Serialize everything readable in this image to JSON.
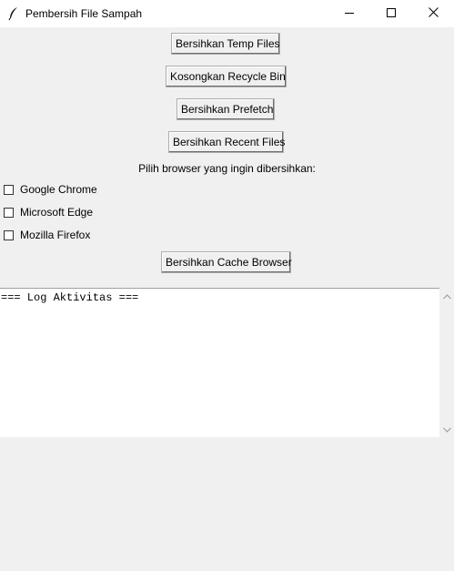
{
  "window": {
    "title": "Pembersih File Sampah"
  },
  "buttons": {
    "temp_files": "Bersihkan Temp Files",
    "recycle_bin": "Kosongkan Recycle Bin",
    "prefetch": "Bersihkan Prefetch",
    "recent_files": "Bersihkan Recent Files",
    "cache_browser": "Bersihkan Cache Browser"
  },
  "browser_section": {
    "prompt": "Pilih browser yang ingin dibersihkan:",
    "options": [
      {
        "label": "Google Chrome",
        "checked": false
      },
      {
        "label": "Microsoft Edge",
        "checked": false
      },
      {
        "label": "Mozilla Firefox",
        "checked": false
      }
    ]
  },
  "log": {
    "text": "=== Log Aktivitas ==="
  },
  "icons": {
    "app": "feather-icon",
    "minimize": "minimize-icon",
    "maximize": "maximize-icon",
    "close": "close-icon",
    "scroll_up": "scroll-up-arrow-icon",
    "scroll_down": "scroll-down-arrow-icon"
  }
}
